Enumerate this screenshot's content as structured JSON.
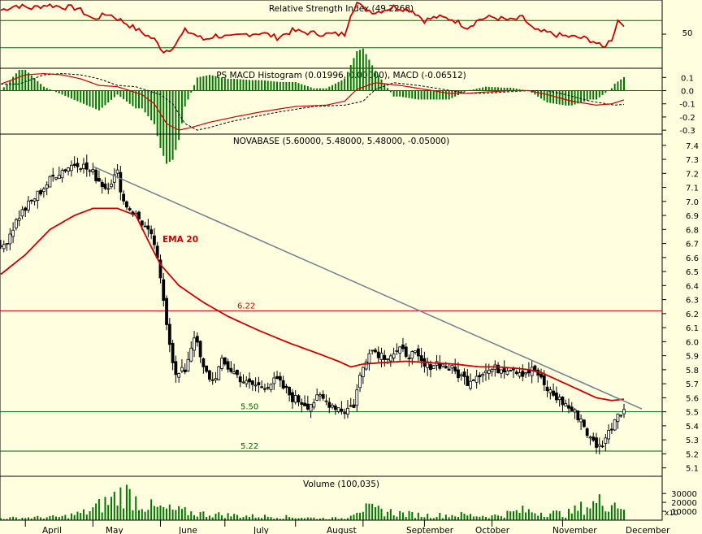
{
  "panels": {
    "rsi": {
      "title": "Relative Strength Index (49.2268)",
      "ticks": [
        "50"
      ],
      "ylim": [
        0,
        100
      ],
      "levels": [
        30,
        70
      ]
    },
    "macd": {
      "title": "PS MACD Histogram (0.01996, 0.00000), MACD (-0.06512)",
      "ticks": [
        "0.1",
        "0.0",
        "-0.1",
        "-0.2",
        "-0.3"
      ],
      "ylim": [
        -0.33,
        0.17
      ]
    },
    "price": {
      "title": "NOVABASE (5.60000, 5.48000, 5.48000, -0.05000)",
      "ticks": [
        "7.4",
        "7.3",
        "7.2",
        "7.1",
        "7.0",
        "6.9",
        "6.8",
        "6.7",
        "6.6",
        "6.5",
        "6.4",
        "6.3",
        "6.2",
        "6.1",
        "6.0",
        "5.9",
        "5.8",
        "5.7",
        "5.6",
        "5.5",
        "5.4",
        "5.3",
        "5.2",
        "5.1"
      ],
      "ylim": [
        5.04,
        7.48
      ],
      "lines": [
        {
          "value": 6.22,
          "label": "6.22",
          "color": "#cc0000"
        },
        {
          "value": 5.5,
          "label": "5.50",
          "color": "#006600"
        },
        {
          "value": 5.22,
          "label": "5.22",
          "color": "#006600"
        }
      ],
      "ema_label": "EMA 20"
    },
    "volume": {
      "title": "Volume (100,035)",
      "ticks": [
        "30000",
        "20000",
        "10000"
      ],
      "multiplier_label": "x10",
      "ylim": [
        0,
        42000
      ]
    }
  },
  "months": [
    "April",
    "May",
    "June",
    "July",
    "August",
    "September",
    "October",
    "November",
    "December"
  ],
  "colors": {
    "background": "#ffffe0",
    "rsi": "#cc0000",
    "ema": "#cc0000",
    "macd": "#cc0000",
    "histogram": "#007700",
    "trendline": "#708090",
    "volume": "#007700"
  },
  "chart_data": {
    "type": "candlestick",
    "title": "NOVABASE (5.60000, 5.48000, 5.48000, -0.05000)",
    "x_range": [
      "April",
      "December"
    ],
    "price_knots": [
      [
        0,
        6.65
      ],
      [
        6,
        6.9
      ],
      [
        12,
        7.05
      ],
      [
        18,
        7.2
      ],
      [
        25,
        7.28
      ],
      [
        30,
        7.2
      ],
      [
        34,
        7.1
      ],
      [
        38,
        7.2
      ],
      [
        40,
        7.0
      ],
      [
        42,
        6.95
      ],
      [
        46,
        6.85
      ],
      [
        50,
        6.7
      ],
      [
        53,
        6.3
      ],
      [
        55,
        6.0
      ],
      [
        57,
        5.75
      ],
      [
        60,
        5.8
      ],
      [
        63,
        6.05
      ],
      [
        66,
        5.8
      ],
      [
        69,
        5.72
      ],
      [
        72,
        5.85
      ],
      [
        76,
        5.78
      ],
      [
        80,
        5.7
      ],
      [
        85,
        5.68
      ],
      [
        90,
        5.72
      ],
      [
        95,
        5.6
      ],
      [
        100,
        5.55
      ],
      [
        104,
        5.6
      ],
      [
        108,
        5.55
      ],
      [
        112,
        5.51
      ],
      [
        115,
        5.55
      ],
      [
        117,
        5.75
      ],
      [
        120,
        5.95
      ],
      [
        125,
        5.9
      ],
      [
        130,
        5.93
      ],
      [
        135,
        5.9
      ],
      [
        138,
        5.82
      ],
      [
        142,
        5.85
      ],
      [
        147,
        5.8
      ],
      [
        152,
        5.72
      ],
      [
        156,
        5.78
      ],
      [
        160,
        5.8
      ],
      [
        166,
        5.82
      ],
      [
        170,
        5.78
      ],
      [
        174,
        5.8
      ],
      [
        177,
        5.68
      ],
      [
        180,
        5.62
      ],
      [
        184,
        5.55
      ],
      [
        189,
        5.45
      ],
      [
        192,
        5.3
      ],
      [
        195,
        5.25
      ],
      [
        198,
        5.35
      ],
      [
        201,
        5.5
      ],
      [
        203,
        5.52
      ]
    ],
    "rsi_knots": [
      [
        0,
        85
      ],
      [
        5,
        92
      ],
      [
        10,
        88
      ],
      [
        15,
        93
      ],
      [
        20,
        90
      ],
      [
        25,
        88
      ],
      [
        30,
        72
      ],
      [
        35,
        80
      ],
      [
        40,
        68
      ],
      [
        45,
        55
      ],
      [
        50,
        42
      ],
      [
        53,
        25
      ],
      [
        55,
        28
      ],
      [
        57,
        36
      ],
      [
        60,
        55
      ],
      [
        63,
        50
      ],
      [
        66,
        42
      ],
      [
        70,
        48
      ],
      [
        75,
        45
      ],
      [
        80,
        50
      ],
      [
        85,
        52
      ],
      [
        90,
        45
      ],
      [
        95,
        55
      ],
      [
        100,
        52
      ],
      [
        106,
        50
      ],
      [
        112,
        50
      ],
      [
        114,
        80
      ],
      [
        116,
        96
      ],
      [
        118,
        88
      ],
      [
        122,
        82
      ],
      [
        128,
        90
      ],
      [
        134,
        85
      ],
      [
        138,
        70
      ],
      [
        142,
        75
      ],
      [
        147,
        72
      ],
      [
        152,
        60
      ],
      [
        156,
        72
      ],
      [
        160,
        75
      ],
      [
        166,
        70
      ],
      [
        170,
        74
      ],
      [
        174,
        55
      ],
      [
        178,
        52
      ],
      [
        182,
        48
      ],
      [
        186,
        46
      ],
      [
        190,
        44
      ],
      [
        193,
        40
      ],
      [
        196,
        30
      ],
      [
        199,
        43
      ],
      [
        201,
        70
      ],
      [
        203,
        65
      ]
    ],
    "macd_knots": [
      [
        0,
        0.05
      ],
      [
        8,
        0.12
      ],
      [
        14,
        0.13
      ],
      [
        20,
        0.12
      ],
      [
        26,
        0.09
      ],
      [
        32,
        0.04
      ],
      [
        38,
        0.03
      ],
      [
        42,
        0.0
      ],
      [
        46,
        -0.03
      ],
      [
        50,
        -0.1
      ],
      [
        54,
        -0.25
      ],
      [
        58,
        -0.3
      ],
      [
        62,
        -0.28
      ],
      [
        68,
        -0.24
      ],
      [
        76,
        -0.2
      ],
      [
        85,
        -0.16
      ],
      [
        96,
        -0.12
      ],
      [
        106,
        -0.11
      ],
      [
        112,
        -0.08
      ],
      [
        116,
        0.01
      ],
      [
        122,
        0.06
      ],
      [
        130,
        0.04
      ],
      [
        138,
        0.01
      ],
      [
        146,
        -0.02
      ],
      [
        152,
        -0.02
      ],
      [
        158,
        -0.01
      ],
      [
        166,
        0.0
      ],
      [
        172,
        0.0
      ],
      [
        178,
        -0.03
      ],
      [
        186,
        -0.08
      ],
      [
        194,
        -0.11
      ],
      [
        199,
        -0.1
      ],
      [
        203,
        -0.07
      ]
    ],
    "ema_knots": [
      [
        0,
        6.48
      ],
      [
        8,
        6.62
      ],
      [
        16,
        6.8
      ],
      [
        24,
        6.9
      ],
      [
        30,
        6.95
      ],
      [
        38,
        6.95
      ],
      [
        44,
        6.9
      ],
      [
        48,
        6.72
      ],
      [
        52,
        6.55
      ],
      [
        58,
        6.4
      ],
      [
        66,
        6.28
      ],
      [
        74,
        6.18
      ],
      [
        84,
        6.08
      ],
      [
        94,
        5.99
      ],
      [
        104,
        5.91
      ],
      [
        110,
        5.86
      ],
      [
        114,
        5.82
      ],
      [
        118,
        5.84
      ],
      [
        124,
        5.85
      ],
      [
        132,
        5.86
      ],
      [
        140,
        5.85
      ],
      [
        148,
        5.84
      ],
      [
        156,
        5.82
      ],
      [
        162,
        5.82
      ],
      [
        168,
        5.81
      ],
      [
        172,
        5.8
      ],
      [
        176,
        5.78
      ],
      [
        182,
        5.72
      ],
      [
        188,
        5.66
      ],
      [
        194,
        5.6
      ],
      [
        199,
        5.58
      ],
      [
        203,
        5.59
      ]
    ],
    "trendline": [
      [
        30,
        7.25
      ],
      [
        203,
        5.52
      ]
    ],
    "volume_knots": [
      [
        0,
        3000
      ],
      [
        20,
        5000
      ],
      [
        28,
        12000
      ],
      [
        36,
        30000
      ],
      [
        40,
        42000
      ],
      [
        46,
        25000
      ],
      [
        50,
        18000
      ],
      [
        56,
        15000
      ],
      [
        64,
        10000
      ],
      [
        72,
        8000
      ],
      [
        82,
        6000
      ],
      [
        92,
        5000
      ],
      [
        104,
        3000
      ],
      [
        112,
        3000
      ],
      [
        116,
        18000
      ],
      [
        124,
        14000
      ],
      [
        132,
        9000
      ],
      [
        140,
        7000
      ],
      [
        150,
        8000
      ],
      [
        160,
        6000
      ],
      [
        170,
        14000
      ],
      [
        176,
        12000
      ],
      [
        184,
        9000
      ],
      [
        190,
        20000
      ],
      [
        196,
        28000
      ],
      [
        200,
        26000
      ],
      [
        203,
        22000
      ]
    ]
  }
}
